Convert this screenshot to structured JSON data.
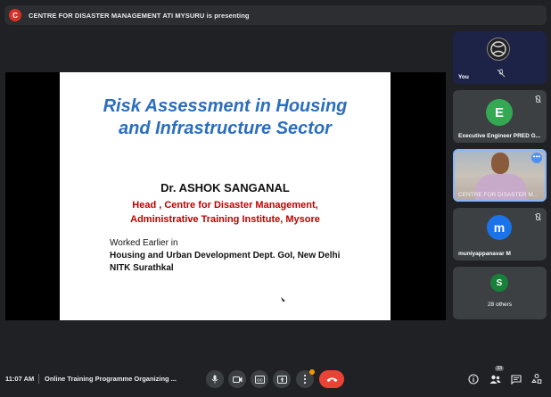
{
  "presenting_bar": {
    "avatar_letter": "C",
    "text": "CENTRE FOR DISASTER MANAGEMENT ATI MYSURU is presenting"
  },
  "slide": {
    "title_line1": "Risk Assessment in Housing",
    "title_line2": "and Infrastructure Sector",
    "presenter_name": "Dr. ASHOK SANGANAL",
    "role_line1": "Head , Centre for Disaster Management,",
    "role_line2": "Administrative Training Institute, Mysore",
    "worked_label": "Worked Earlier in",
    "experience": [
      "Housing and Urban Development Dept. GoI, New Delhi",
      "NITK Surathkal"
    ]
  },
  "participants": [
    {
      "label": "You",
      "avatar": "",
      "muted": true
    },
    {
      "label": "Executive Engineer PRED G...",
      "avatar": "E",
      "avatar_color": "#34a853",
      "muted": true
    },
    {
      "label": "CENTRE FOR DISASTER M...",
      "avatar": "",
      "video": true,
      "muted": false
    },
    {
      "label": "muniyappanavar M",
      "avatar": "m",
      "avatar_color": "#1a73e8",
      "muted": true
    },
    {
      "label": "28 others",
      "avatar": "S",
      "avatar_color": "#188038",
      "muted": false
    }
  ],
  "bottom_bar": {
    "time": "11:07 AM",
    "meeting_title": "Online Training Programme Organizing ...",
    "participant_count": "33",
    "controls": [
      "mic-icon",
      "camera-icon",
      "captions-icon",
      "present-icon",
      "more-icon",
      "end-call-icon"
    ],
    "right_icons": [
      "info-icon",
      "people-icon",
      "chat-icon",
      "activities-icon"
    ]
  },
  "colors": {
    "background": "#202124",
    "slide_title": "#2a6ebf",
    "slide_role": "#c00000",
    "end_call": "#ea4335",
    "accent": "#8ab4f8"
  }
}
